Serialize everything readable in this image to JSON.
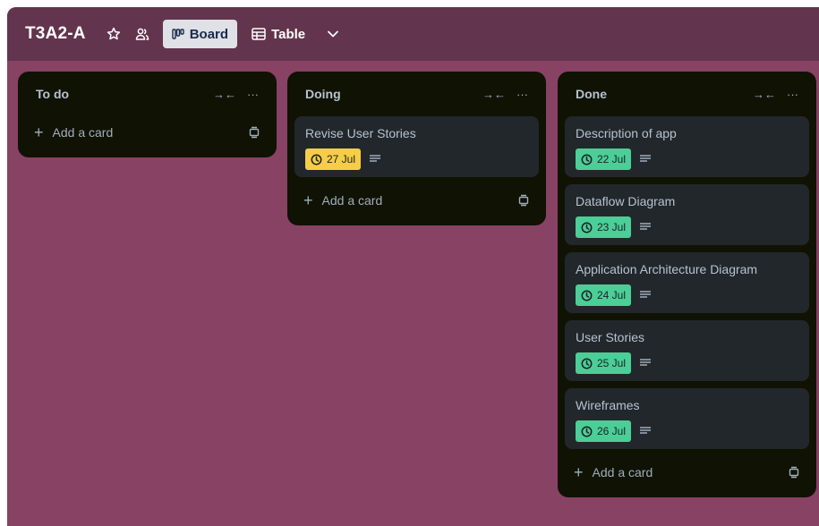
{
  "board": {
    "title": "T3A2-A",
    "views": [
      {
        "label": "Board",
        "active": true
      },
      {
        "label": "Table",
        "active": false
      }
    ]
  },
  "colors": {
    "board_bg": "#874264",
    "header_bg": "#63344d",
    "list_bg": "#101204",
    "card_bg": "#22272b",
    "due_green": "#4bce97",
    "due_yellow": "#f5cd47"
  },
  "icons": [
    "star-icon",
    "people-icon",
    "board-view-icon",
    "table-view-icon",
    "chevron-down-icon",
    "collapse-icon",
    "more-icon",
    "clock-icon",
    "description-icon",
    "plus-icon",
    "template-icon"
  ],
  "lists": [
    {
      "title": "To do",
      "add_label": "Add a card",
      "cards": []
    },
    {
      "title": "Doing",
      "add_label": "Add a card",
      "cards": [
        {
          "title": "Revise User Stories",
          "due": "27 Jul",
          "due_status": "yellow"
        }
      ]
    },
    {
      "title": "Done",
      "add_label": "Add a card",
      "cards": [
        {
          "title": "Description of app",
          "due": "22 Jul",
          "due_status": "green"
        },
        {
          "title": "Dataflow Diagram",
          "due": "23 Jul",
          "due_status": "green"
        },
        {
          "title": "Application Architecture Diagram",
          "due": "24 Jul",
          "due_status": "green"
        },
        {
          "title": "User Stories",
          "due": "25 Jul",
          "due_status": "green"
        },
        {
          "title": "Wireframes",
          "due": "26 Jul",
          "due_status": "green"
        }
      ]
    }
  ]
}
